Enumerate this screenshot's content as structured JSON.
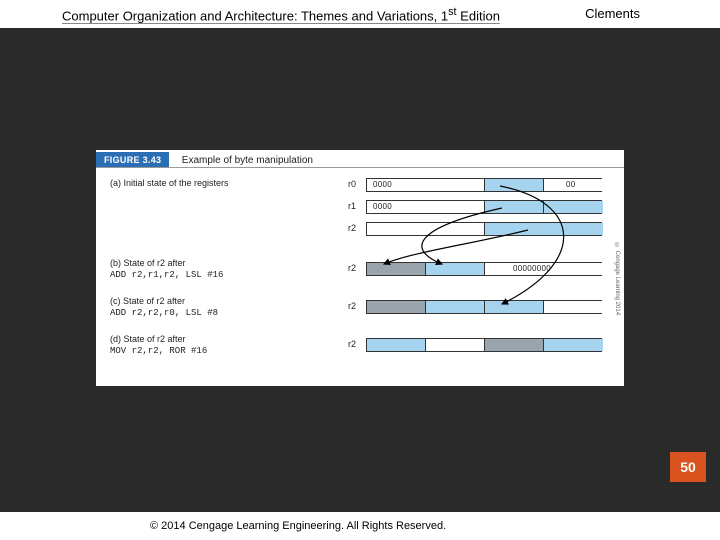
{
  "header": {
    "title_pre": "Computer Organization and Architecture: Themes and Variations, 1",
    "title_sup": "st",
    "title_post": " Edition",
    "author": "Clements"
  },
  "figure": {
    "badge": "FIGURE 3.43",
    "caption": "Example of byte manipulation",
    "credit": "© Cengage Learning 2014",
    "rows": {
      "a": {
        "label": "(a) Initial state of the registers",
        "reg0": "r0",
        "reg0_left": "0000",
        "reg0_right": "00",
        "reg1": "r1",
        "reg1_left": "0000",
        "reg2": "r2"
      },
      "b": {
        "label": "(b) State of r2 after",
        "instr": "ADD r2,r1,r2, LSL #16",
        "reg": "r2",
        "boxtext": "00000000"
      },
      "c": {
        "label": "(c) State of r2 after",
        "instr": "ADD r2,r2,r0, LSL #8",
        "reg": "r2"
      },
      "d": {
        "label": "(d) State of r2 after",
        "instr": "MOV r2,r2, ROR #16",
        "reg": "r2"
      }
    }
  },
  "page_number": "50",
  "footer": "© 2014 Cengage Learning Engineering. All Rights Reserved."
}
